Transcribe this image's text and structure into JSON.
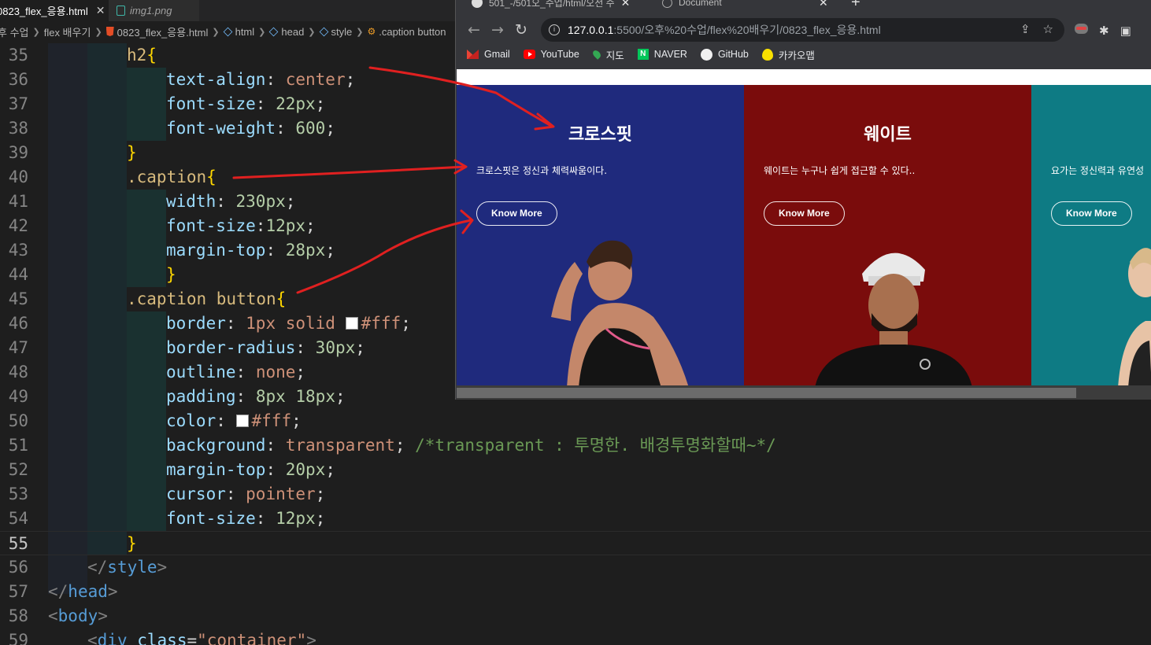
{
  "editor": {
    "tabs": [
      {
        "label": "0823_flex_응용.html",
        "close": "✕"
      },
      {
        "label": "img1.png"
      }
    ],
    "breadcrumb": [
      "후 수업",
      "flex 배우기",
      "0823_flex_응용.html",
      "html",
      "head",
      "style",
      ".caption button"
    ],
    "lines": [
      {
        "n": "35"
      },
      {
        "n": "36"
      },
      {
        "n": "37"
      },
      {
        "n": "38"
      },
      {
        "n": "39"
      },
      {
        "n": "40"
      },
      {
        "n": "41"
      },
      {
        "n": "42"
      },
      {
        "n": "43"
      },
      {
        "n": "44"
      },
      {
        "n": "45"
      },
      {
        "n": "46"
      },
      {
        "n": "47"
      },
      {
        "n": "48"
      },
      {
        "n": "49"
      },
      {
        "n": "50"
      },
      {
        "n": "51"
      },
      {
        "n": "52"
      },
      {
        "n": "53"
      },
      {
        "n": "54"
      },
      {
        "n": "55"
      },
      {
        "n": "56"
      },
      {
        "n": "57"
      },
      {
        "n": "58"
      },
      {
        "n": "59"
      }
    ],
    "code": {
      "l35_sel": "h2",
      "open_brace": "{",
      "close_brace": "}",
      "l36_prop": "text-align",
      "l36_val": "center",
      "l37_prop": "font-size",
      "l37_val": "22px",
      "l38_prop": "font-weight",
      "l38_val": "600",
      "l40_sel": ".caption",
      "l41_prop": "width",
      "l41_val": "230px",
      "l42_prop": "font-size",
      "l42_val": "12px",
      "l43_prop": "margin-top",
      "l43_val": "28px",
      "l45_sel": ".caption button",
      "l46_prop": "border",
      "l46_val1": "1px solid",
      "l46_val2": "#fff",
      "l47_prop": "border-radius",
      "l47_val": "30px",
      "l48_prop": "outline",
      "l48_val": "none",
      "l49_prop": "padding",
      "l49_val": "8px 18px",
      "l50_prop": "color",
      "l50_val": "#fff",
      "l51_prop": "background",
      "l51_val": "transparent",
      "l51_cmt": "/*transparent : 투명한. 배경투명화할때~*/",
      "l52_prop": "margin-top",
      "l52_val": "20px",
      "l53_prop": "cursor",
      "l53_val": "pointer",
      "l54_prop": "font-size",
      "l54_val": "12px",
      "l56": "style",
      "l57": "head",
      "l58": "body",
      "l59_tag": "div",
      "l59_attr": "class",
      "l59_val": "\"container\""
    },
    "current_line": "55"
  },
  "browser": {
    "tabs": [
      {
        "label": "501_-/501오_수업/html/오전 수",
        "close": "✕"
      },
      {
        "label": "Document",
        "close": "✕"
      }
    ],
    "new_tab": "+",
    "url_host": "127.0.0.1",
    "url_rest": ":5500/오후%20수업/flex%20배우기/0823_flex_응용.html",
    "bookmarks": [
      {
        "label": "Gmail",
        "icon": "gmail-icon"
      },
      {
        "label": "YouTube",
        "icon": "youtube-icon"
      },
      {
        "label": "지도",
        "icon": "maps-icon"
      },
      {
        "label": "NAVER",
        "icon": "naver-icon"
      },
      {
        "label": "GitHub",
        "icon": "github-icon"
      },
      {
        "label": "카카오맵",
        "icon": "kakaomap-icon"
      }
    ],
    "cards": [
      {
        "title": "크로스핏",
        "caption": "크로스핏은 정신과 체력싸움이다.",
        "button": "Know More",
        "bg": "#1f2a7d"
      },
      {
        "title": "웨이트",
        "caption": "웨이트는 누구나 쉽게 접근할 수 있다..",
        "button": "Know More",
        "bg": "#7a0c0c"
      },
      {
        "title": "",
        "caption": "요가는 정신력과 유연성",
        "button": "Know More",
        "bg": "#0e7b84"
      }
    ]
  },
  "colors": {
    "annotation_red": "#e02020"
  }
}
